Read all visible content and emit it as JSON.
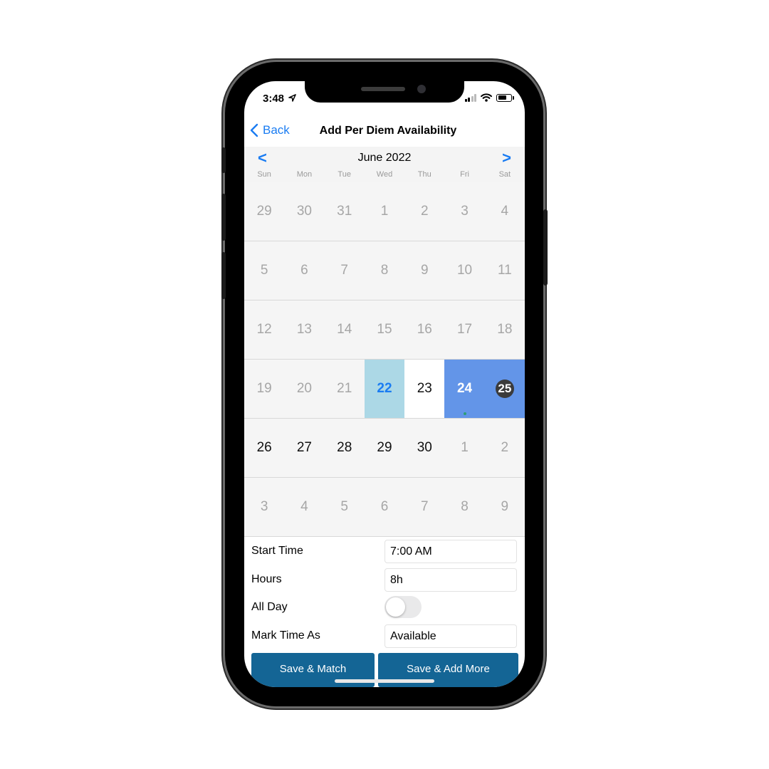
{
  "status_bar": {
    "time": "3:48"
  },
  "nav": {
    "back_label": "Back",
    "title": "Add Per Diem Availability"
  },
  "calendar": {
    "month_label": "June 2022",
    "prev_label": "<",
    "next_label": ">",
    "weekdays": [
      "Sun",
      "Mon",
      "Tue",
      "Wed",
      "Thu",
      "Fri",
      "Sat"
    ],
    "weeks": [
      [
        {
          "n": "29",
          "s": "other"
        },
        {
          "n": "30",
          "s": "other"
        },
        {
          "n": "31",
          "s": "other"
        },
        {
          "n": "1",
          "s": "other"
        },
        {
          "n": "2",
          "s": "other"
        },
        {
          "n": "3",
          "s": "other"
        },
        {
          "n": "4",
          "s": "other"
        }
      ],
      [
        {
          "n": "5",
          "s": "other"
        },
        {
          "n": "6",
          "s": "other"
        },
        {
          "n": "7",
          "s": "other"
        },
        {
          "n": "8",
          "s": "other"
        },
        {
          "n": "9",
          "s": "other"
        },
        {
          "n": "10",
          "s": "other"
        },
        {
          "n": "11",
          "s": "other"
        }
      ],
      [
        {
          "n": "12",
          "s": "other"
        },
        {
          "n": "13",
          "s": "other"
        },
        {
          "n": "14",
          "s": "other"
        },
        {
          "n": "15",
          "s": "other"
        },
        {
          "n": "16",
          "s": "other"
        },
        {
          "n": "17",
          "s": "other"
        },
        {
          "n": "18",
          "s": "other"
        }
      ],
      [
        {
          "n": "19",
          "s": "other"
        },
        {
          "n": "20",
          "s": "other"
        },
        {
          "n": "21",
          "s": "other"
        },
        {
          "n": "22",
          "s": "today"
        },
        {
          "n": "23",
          "s": "white"
        },
        {
          "n": "24",
          "s": "selected",
          "dot": true
        },
        {
          "n": "25",
          "s": "selected-circle"
        }
      ],
      [
        {
          "n": "26",
          "s": "cur"
        },
        {
          "n": "27",
          "s": "cur"
        },
        {
          "n": "28",
          "s": "cur"
        },
        {
          "n": "29",
          "s": "cur"
        },
        {
          "n": "30",
          "s": "cur"
        },
        {
          "n": "1",
          "s": "other"
        },
        {
          "n": "2",
          "s": "other"
        }
      ],
      [
        {
          "n": "3",
          "s": "other"
        },
        {
          "n": "4",
          "s": "other"
        },
        {
          "n": "5",
          "s": "other"
        },
        {
          "n": "6",
          "s": "other"
        },
        {
          "n": "7",
          "s": "other"
        },
        {
          "n": "8",
          "s": "other"
        },
        {
          "n": "9",
          "s": "other"
        }
      ]
    ]
  },
  "form": {
    "start_time_label": "Start Time",
    "start_time_value": "7:00 AM",
    "hours_label": "Hours",
    "hours_value": "8h",
    "all_day_label": "All Day",
    "all_day_on": false,
    "mark_time_label": "Mark Time As",
    "mark_time_value": "Available"
  },
  "buttons": {
    "save_match": "Save & Match",
    "save_add_more": "Save & Add More"
  },
  "colors": {
    "accent": "#1a7cf2",
    "today_bg": "#acd8e6",
    "selected_bg": "#6395e8",
    "button_bg": "#146595"
  }
}
